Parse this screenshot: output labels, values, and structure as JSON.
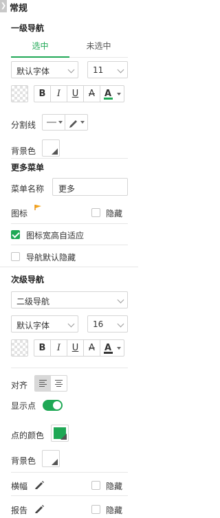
{
  "section": {
    "title": "常规",
    "collapse_glyph": "❯"
  },
  "primary_nav": {
    "title": "一级导航",
    "tabs": [
      {
        "label": "选中",
        "active": true
      },
      {
        "label": "未选中",
        "active": false
      }
    ],
    "font_family": "默认字体",
    "font_size": "11",
    "format_buttons": [
      "B",
      "I",
      "U",
      "A"
    ],
    "font_color_label": "A",
    "font_color": "#1fa855",
    "divider_label": "分割线",
    "background_label": "背景色"
  },
  "more_menu": {
    "title": "更多菜单",
    "name_label": "菜单名称",
    "name_value": "更多",
    "icon_label": "图标",
    "icon_color": "#f4a51c",
    "hide_label": "隐藏",
    "hide_checked": false,
    "adaptive_label": "图标宽高自适应",
    "adaptive_checked": true,
    "nav_hide_label": "导航默认隐藏",
    "nav_hide_checked": false
  },
  "secondary_nav": {
    "title": "次级导航",
    "nav_select": "二级导航",
    "font_family": "默认字体",
    "font_size": "16",
    "format_buttons": [
      "B",
      "I",
      "U",
      "A"
    ],
    "font_color_label": "A",
    "align_label": "对齐",
    "show_dot_label": "显示点",
    "show_dot_on": true,
    "dot_color_label": "点的颜色",
    "dot_color": "#1fa855",
    "background_label": "背景色",
    "banner_label": "横幅",
    "banner_hide_label": "隐藏",
    "report_label": "报告",
    "report_hide_label": "隐藏"
  }
}
